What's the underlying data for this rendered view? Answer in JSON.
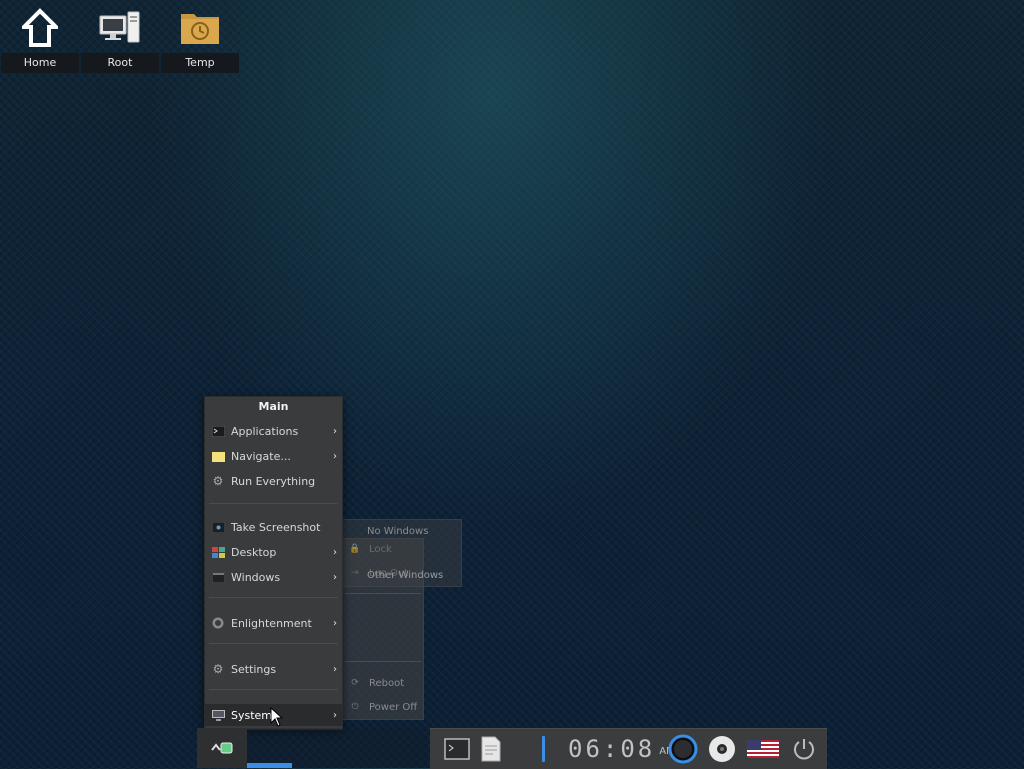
{
  "desktop": {
    "icons": [
      {
        "label": "Home",
        "icon": "home-icon"
      },
      {
        "label": "Root",
        "icon": "computer-icon"
      },
      {
        "label": "Temp",
        "icon": "folder-clock-icon"
      }
    ]
  },
  "main_menu": {
    "title": "Main",
    "items": [
      {
        "label": "Applications",
        "icon": "terminal-icon",
        "submenu": true
      },
      {
        "label": "Navigate...",
        "icon": "folder-icon",
        "submenu": true
      },
      {
        "label": "Run Everything",
        "icon": "gear-icon",
        "submenu": false
      },
      {
        "label": "Take Screenshot",
        "icon": "screenshot-icon",
        "submenu": false
      },
      {
        "label": "Desktop",
        "icon": "desktop-icon",
        "submenu": true
      },
      {
        "label": "Windows",
        "icon": "windows-icon",
        "submenu": true
      },
      {
        "label": "Enlightenment",
        "icon": "enlightenment-icon",
        "submenu": true
      },
      {
        "label": "Settings",
        "icon": "settings-icon",
        "submenu": true
      },
      {
        "label": "System",
        "icon": "monitor-icon",
        "submenu": true,
        "active": true
      }
    ]
  },
  "system_submenu": {
    "items": [
      {
        "label": "Lock",
        "icon": "lock-icon"
      },
      {
        "label": "Log Out",
        "icon": "logout-icon"
      },
      {
        "label": "Reboot",
        "icon": "reboot-icon"
      },
      {
        "label": "Power Off",
        "icon": "power-icon"
      }
    ]
  },
  "windows_submenu": {
    "items": [
      {
        "label": "No Windows"
      },
      {
        "label": "Other Windows"
      }
    ]
  },
  "shelf": {
    "clock": {
      "time": "06:08",
      "ampm": "AM"
    },
    "tray_icons": [
      "terminal-icon",
      "file-icon",
      "volume-icon",
      "connman-icon",
      "disc-icon",
      "us-flag-icon",
      "power-icon"
    ],
    "accent": "#3a8ee6"
  }
}
